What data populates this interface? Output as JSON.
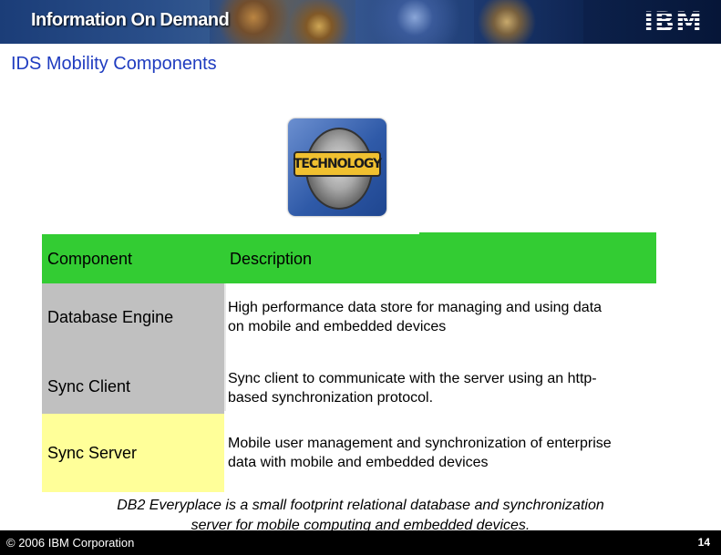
{
  "banner": {
    "title": "Information On Demand",
    "logo": "IBM"
  },
  "page_title": "IDS Mobility Components",
  "award": {
    "band_text": "TECHNOLOGY"
  },
  "table": {
    "headers": [
      "Component",
      "Description"
    ],
    "rows": [
      {
        "component": "Database Engine",
        "description_lines": [
          "High performance data store for managing and using data",
          "on mobile and embedded devices"
        ]
      },
      {
        "component": "Sync Client",
        "description_lines": [
          "Sync client to communicate with the server using an http-",
          "based synchronization protocol."
        ]
      },
      {
        "component": "Sync Server",
        "description_lines": [
          "Mobile user management and synchronization of enterprise",
          "data with mobile and embedded devices"
        ]
      }
    ]
  },
  "note_lines": [
    "DB2 Everyplace is a small footprint relational database and synchronization",
    "server for mobile computing and embedded devices."
  ],
  "footer": {
    "copyright": "© 2006 IBM Corporation",
    "page_number": "14"
  },
  "colors": {
    "header_green": "#33cc33",
    "component_gray": "#c0c0c0",
    "highlight_yellow": "#ffff99",
    "title_blue": "#1f3cc0"
  }
}
